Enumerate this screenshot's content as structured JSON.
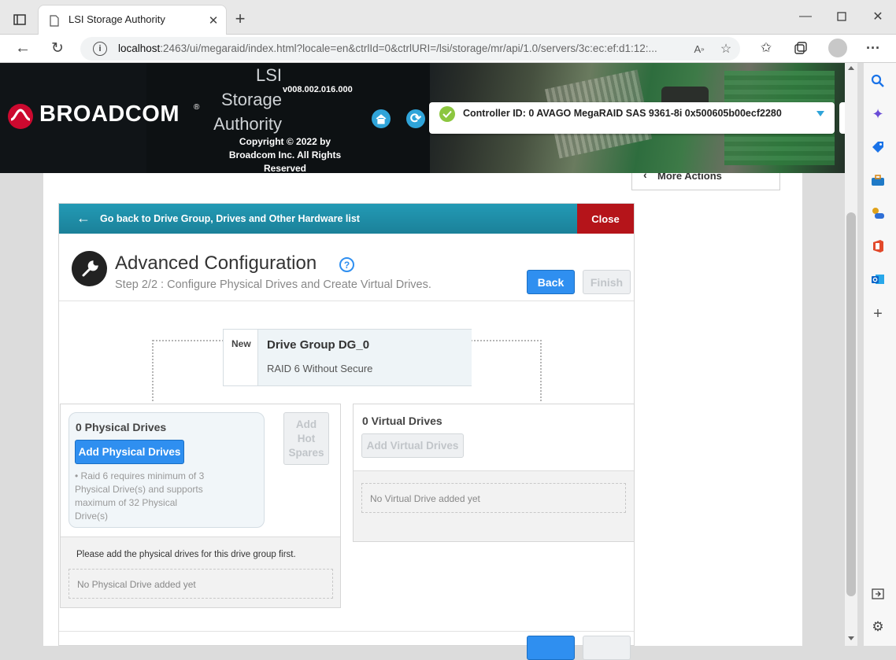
{
  "browser": {
    "tab_title": "LSI Storage Authority",
    "url_host": "localhost",
    "url_rest": ":2463/ui/megaraid/index.html?locale=en&ctrlId=0&ctrlURI=/lsi/storage/mr/api/1.0/servers/3c:ec:ef:d1:12:..."
  },
  "header": {
    "brand": "BROADCOM",
    "app_line1": "LSI",
    "app_line2": "Storage",
    "app_line3": "Authority",
    "version": "v008.002.016.000",
    "copyright": "Copyright © 2022 by Broadcom Inc. All Rights Reserved",
    "controller": "Controller ID: 0 AVAGO MegaRAID SAS 9361-8i 0x500605b00ecf2280"
  },
  "more_actions": "More Actions",
  "wizard": {
    "back_link": "Go back to Drive Group, Drives and Other Hardware list",
    "close": "Close",
    "title": "Advanced Configuration",
    "subtitle": "Step 2/2 : Configure Physical Drives and Create Virtual Drives.",
    "back_btn": "Back",
    "finish_btn": "Finish"
  },
  "drive_group": {
    "new_label": "New",
    "name": "Drive Group DG_0",
    "raid": "RAID 6 Without Secure"
  },
  "physical": {
    "count_label": "0 Physical Drives",
    "add_btn": "Add Physical Drives",
    "hot_spares": "Add Hot Spares",
    "note": "• Raid 6 requires minimum of 3 Physical Drive(s) and supports maximum of 32 Physical Drive(s)",
    "hint": "Please add the physical drives for this drive group first.",
    "empty": "No Physical Drive added yet"
  },
  "virtual": {
    "count_label": "0 Virtual Drives",
    "add_btn": "Add Virtual Drives",
    "empty": "No Virtual Drive added yet"
  },
  "colors": {
    "accent": "#2f8ff0",
    "teal": "#1f8da8",
    "close_red": "#b5141a",
    "broadcom_red": "#cc092f"
  }
}
